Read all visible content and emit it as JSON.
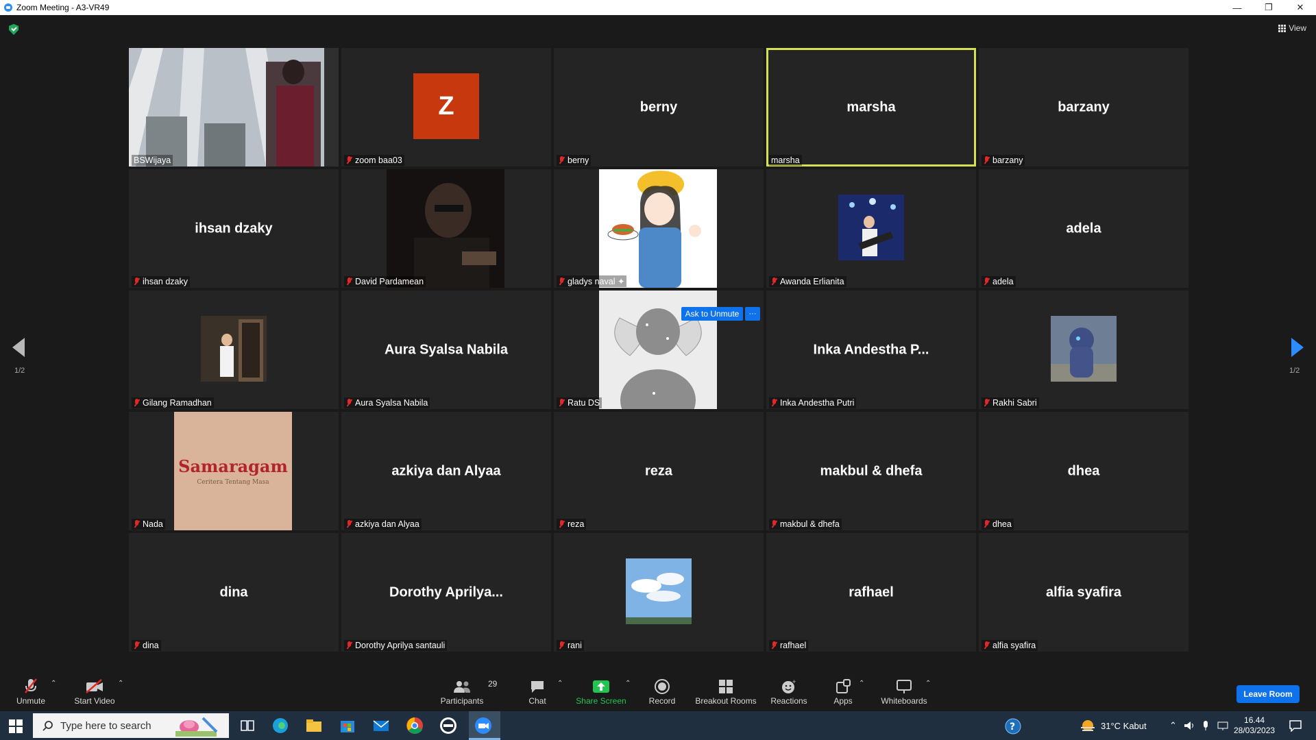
{
  "window": {
    "title": "Zoom Meeting - A3-VR49"
  },
  "header": {
    "view_label": "View"
  },
  "pagination": {
    "left": "1/2",
    "right": "1/2"
  },
  "tiles": [
    {
      "big": "",
      "label": "BSWijaya"
    },
    {
      "big": "",
      "avatar_letter": "Z",
      "label": "zoom baa03"
    },
    {
      "big": "berny",
      "label": "berny"
    },
    {
      "big": "marsha",
      "label": "marsha"
    },
    {
      "big": "barzany",
      "label": "barzany"
    },
    {
      "big": "ihsan dzaky",
      "label": "ihsan dzaky"
    },
    {
      "big": "",
      "label": "David Pardamean"
    },
    {
      "big": "",
      "label": "gladys naval ✦"
    },
    {
      "big": "",
      "label": "Awanda Erlianita"
    },
    {
      "big": "adela",
      "label": "adela"
    },
    {
      "big": "",
      "label": "Gilang Ramadhan"
    },
    {
      "big": "Aura Syalsa Nabila",
      "label": "Aura Syalsa Nabila"
    },
    {
      "big": "",
      "label": "Ratu DS"
    },
    {
      "big": "Inka Andestha P...",
      "label": "Inka Andestha Putri"
    },
    {
      "big": "",
      "label": "Rakhi Sabri"
    },
    {
      "big": "",
      "label": "Nada",
      "logo_text": "Samaragam",
      "logo_sub": "Ceritera Tentang Masa"
    },
    {
      "big": "azkiya dan Alyaa",
      "label": "azkiya dan Alyaa"
    },
    {
      "big": "reza",
      "label": "reza"
    },
    {
      "big": "makbul & dhefa",
      "label": "makbul & dhefa"
    },
    {
      "big": "dhea",
      "label": "dhea"
    },
    {
      "big": "dina",
      "label": "dina"
    },
    {
      "big": "Dorothy  Aprilya...",
      "label": "Dorothy Aprilya santauli"
    },
    {
      "big": "",
      "label": "rani"
    },
    {
      "big": "rafhael",
      "label": "rafhael"
    },
    {
      "big": "alfia syafira",
      "label": "alfia syafira"
    }
  ],
  "ask_unmute": {
    "label": "Ask to Unmute",
    "more": "···"
  },
  "toolbar": {
    "unmute": "Unmute",
    "start_video": "Start Video",
    "participants": "Participants",
    "participants_count": "29",
    "chat": "Chat",
    "share_screen": "Share Screen",
    "record": "Record",
    "breakout": "Breakout Rooms",
    "reactions": "Reactions",
    "apps": "Apps",
    "whiteboards": "Whiteboards",
    "leave": "Leave Room"
  },
  "taskbar": {
    "search_placeholder": "Type here to search",
    "weather": "31°C  Kabut",
    "time": "16.44",
    "date": "28/03/2023"
  },
  "colors": {
    "accent": "#0e72ed",
    "active_speaker": "#d4e157",
    "muted": "#e02828",
    "zoom_avatar": "#c8380e"
  }
}
